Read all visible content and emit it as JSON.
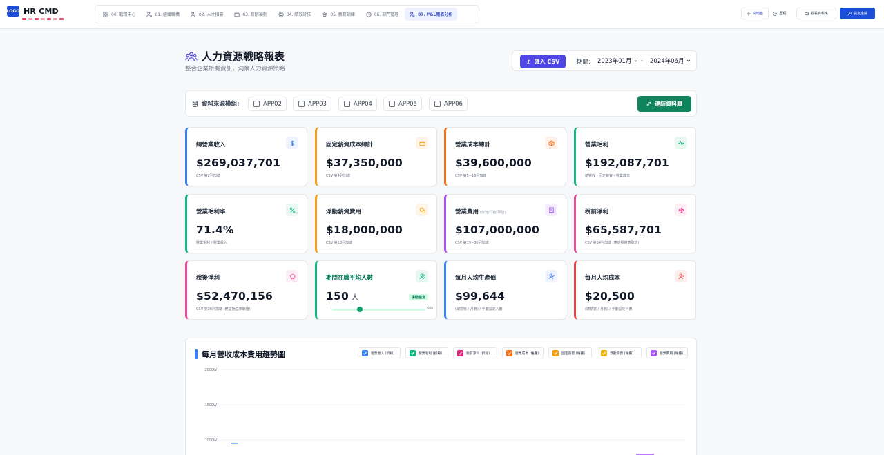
{
  "app": {
    "title": "HR CMD",
    "logo_badge": "LOGO",
    "logo_dots": [
      "HR1",
      "HR2",
      "HR3",
      "HR4",
      "HR5",
      "HR6",
      "HR7"
    ]
  },
  "nav": {
    "items": [
      {
        "label": "00. 戰情中心",
        "icon": "grid-icon"
      },
      {
        "label": "01. 組織職構",
        "icon": "users-icon"
      },
      {
        "label": "02. 人才招募",
        "icon": "user-plus-icon"
      },
      {
        "label": "03. 薪酬福利",
        "icon": "wallet-icon"
      },
      {
        "label": "04. 績效評核",
        "icon": "target-icon"
      },
      {
        "label": "05. 教育訓練",
        "icon": "graduation-icon"
      },
      {
        "label": "06. 部門管理",
        "icon": "clock-icon"
      },
      {
        "label": "07. P&L報表分析",
        "icon": "users-gear-icon",
        "active": true
      }
    ]
  },
  "topbar_right": {
    "theme_label": "亮暗色",
    "history_label": "歷程",
    "report_label": "觀看資料夾",
    "login_label": "設定金鑰"
  },
  "header": {
    "title": "人力資源戰略報表",
    "subtitle": "整合企業所有資訊，洞察人力資源策略",
    "import_label": "匯入 CSV",
    "period_label": "期間:",
    "period_start": "2023年01月",
    "period_end": "2024年06月",
    "period_dash": "-"
  },
  "sources": {
    "label": "資料來源模組:",
    "modules": [
      "APP02",
      "APP03",
      "APP04",
      "APP05",
      "APP06"
    ],
    "connect_label": "連結資料庫"
  },
  "kpis": [
    {
      "title": "總營業收入",
      "value": "$269,037,701",
      "note": "CSV 第2列加總",
      "color": "#3b82f6",
      "icon": "dollar-icon",
      "icon_bg": "#eef3ff",
      "icon_color": "#3b82f6"
    },
    {
      "title": "固定薪資成本總計",
      "value": "$37,350,000",
      "note": "CSV 第4列加總",
      "color": "#f59e0b",
      "icon": "wallet-icon",
      "icon_bg": "#fff5e6",
      "icon_color": "#f59e0b"
    },
    {
      "title": "營業成本總計",
      "value": "$39,600,000",
      "note": "CSV 第5~16列加總",
      "color": "#f97316",
      "icon": "box-icon",
      "icon_bg": "#fff1e8",
      "icon_color": "#f97316"
    },
    {
      "title": "營業毛利",
      "value": "$192,087,701",
      "note": "總營收 - 固定薪資 - 營業成本",
      "color": "#10b981",
      "icon": "activity-icon",
      "icon_bg": "#e8f8f1",
      "icon_color": "#10b981"
    },
    {
      "title": "營業毛利率",
      "value": "71.4%",
      "note": "營業毛利 / 營業收入",
      "color": "#10b981",
      "icon": "percent-icon",
      "icon_bg": "#e8f8f1",
      "icon_color": "#10b981"
    },
    {
      "title": "浮動薪資費用",
      "value": "$18,000,000",
      "note": "CSV 第18列加總",
      "color": "#f59e0b",
      "icon": "coins-icon",
      "icon_bg": "#fff5e6",
      "icon_color": "#f59e0b"
    },
    {
      "title": "營業費用",
      "title_note": "(依管/行銷/研發)",
      "value": "$107,000,000",
      "note": "CSV 第19~30列加總",
      "color": "#a855f7",
      "icon": "receipt-icon",
      "icon_bg": "#f5edff",
      "icon_color": "#a855f7"
    },
    {
      "title": "稅前淨利",
      "value": "$65,587,701",
      "note": "CSV 第34列加總 (應從損益表取值)",
      "color": "#ec4899",
      "icon": "scale-icon",
      "icon_bg": "#fdedf5",
      "icon_color": "#ec4899"
    },
    {
      "title": "稅後淨利",
      "value": "$52,470,156",
      "note": "CSV 第36列加總 (應從損益表取值)",
      "color": "#ec4899",
      "icon": "piggy-bank-icon",
      "icon_bg": "#fdedf5",
      "icon_color": "#ec4899"
    },
    {
      "title": "期間在職平均人數",
      "value": "150",
      "unit": "人",
      "badge": "手動設定",
      "slider_min": "1",
      "slider_max": "500",
      "slider_value": 150,
      "slider_range": [
        1,
        500
      ],
      "color": "#10b981",
      "icon": "users-icon",
      "icon_bg": "#e8f8f1",
      "icon_color": "#10b981",
      "title_color": "#047857"
    },
    {
      "title": "每月人均生產值",
      "value": "$99,644",
      "note": "(總營收 / 月數) / 手動設定人數",
      "color": "#3b82f6",
      "icon": "user-check-icon",
      "icon_bg": "#eef3ff",
      "icon_color": "#3b82f6"
    },
    {
      "title": "每月人均成本",
      "value": "$20,500",
      "note": "(總薪資 / 月數) / 手動設定人數",
      "color": "#ef4444",
      "icon": "user-minus-icon",
      "icon_bg": "#fdeeee",
      "icon_color": "#ef4444"
    }
  ],
  "chart": {
    "title": "每月營收成本費用趨勢圖",
    "legend": [
      {
        "label": "營業收入 (折線)",
        "color": "#3b82f6"
      },
      {
        "label": "營業毛利 (折線)",
        "color": "#10b981"
      },
      {
        "label": "稅前淨利 (折線)",
        "color": "#db2777"
      },
      {
        "label": "營業成本 (堆疊)",
        "color": "#f97316"
      },
      {
        "label": "固定薪資 (堆疊)",
        "color": "#f59e0b"
      },
      {
        "label": "浮動薪資 (堆疊)",
        "color": "#eab308"
      },
      {
        "label": "營業費用 (堆疊)",
        "color": "#a855f7"
      }
    ],
    "yticks": [
      "2000W",
      "1500W",
      "1000W"
    ]
  },
  "chart_data": {
    "type": "line",
    "title": "每月營收成本費用趨勢圖",
    "ylim": [
      1000,
      2000
    ],
    "yticks": [
      "2000W",
      "1500W",
      "1000W"
    ],
    "series": [
      {
        "name": "營業收入 (折線)"
      },
      {
        "name": "營業毛利 (折線)"
      },
      {
        "name": "稅前淨利 (折線)"
      },
      {
        "name": "營業成本 (堆疊)"
      },
      {
        "name": "固定薪資 (堆疊)"
      },
      {
        "name": "浮動薪資 (堆疊)"
      },
      {
        "name": "營業費用 (堆疊)"
      }
    ],
    "grid": true,
    "legend_position": "top-right"
  }
}
